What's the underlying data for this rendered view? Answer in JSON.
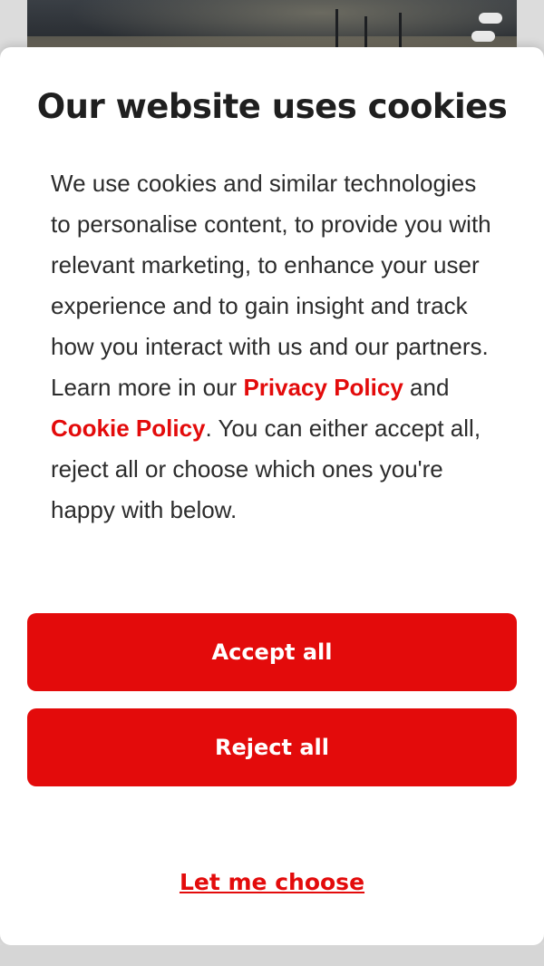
{
  "cookie_modal": {
    "title": "Our website uses cookies",
    "text_intro": "We use cookies and similar technologies to personalise content, to provide you with relevant marketing, to enhance your user experience and to gain insight and track how you interact with us and our partners. Learn more in our ",
    "privacy_link": "Privacy Policy",
    "text_and": " and ",
    "cookie_link": "Cookie Policy",
    "text_outro": ". You can either accept all, reject all or choose which ones you're happy with below.",
    "accept_label": "Accept all",
    "reject_label": "Reject all",
    "choose_label": "Let me choose"
  },
  "colors": {
    "accent": "#e30b0b",
    "text": "#2c2c2c",
    "title": "#1f1f1f",
    "background": "#ffffff"
  }
}
